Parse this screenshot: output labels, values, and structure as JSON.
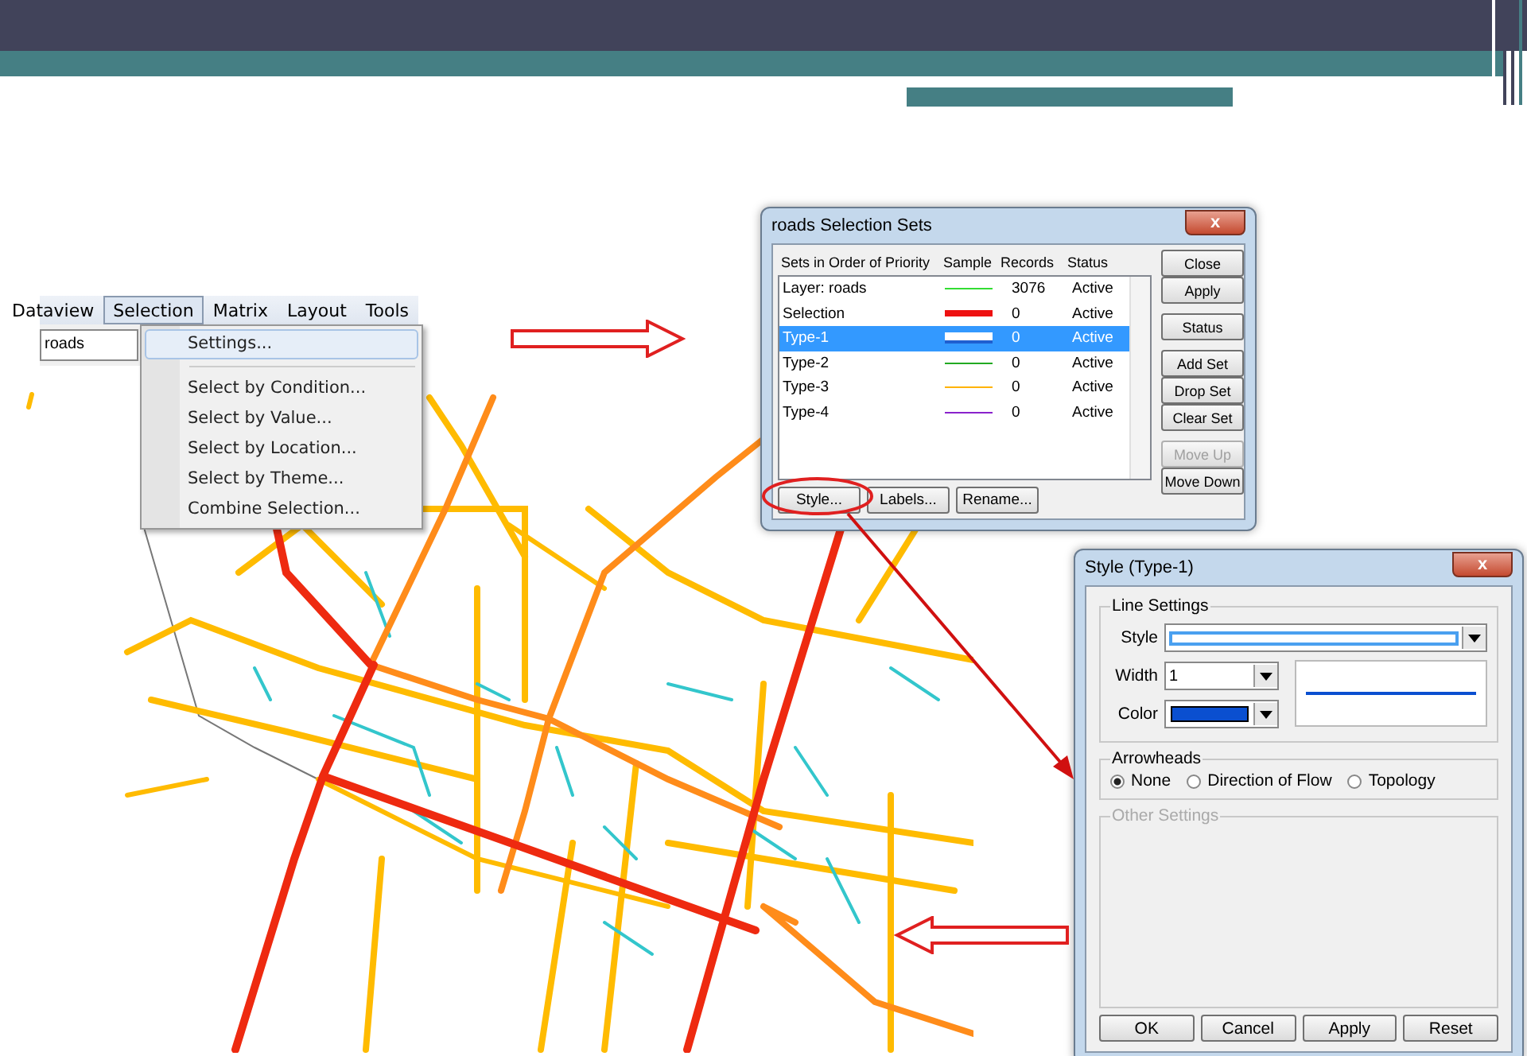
{
  "menu_bar": {
    "items": [
      {
        "label": "Dataview",
        "selected": false
      },
      {
        "label": "Selection",
        "selected": true
      },
      {
        "label": "Matrix",
        "selected": false
      },
      {
        "label": "Layout",
        "selected": false
      },
      {
        "label": "Tools",
        "selected": false
      }
    ]
  },
  "layer_field": {
    "value": "roads"
  },
  "selection_menu": {
    "items": [
      {
        "kind": "item",
        "label": "Settings...",
        "highlighted": true
      },
      {
        "kind": "separator"
      },
      {
        "kind": "item",
        "label": "Select by Condition...",
        "highlighted": false
      },
      {
        "kind": "item",
        "label": "Select by Value...",
        "highlighted": false
      },
      {
        "kind": "item",
        "label": "Select by Location...",
        "highlighted": false
      },
      {
        "kind": "item",
        "label": "Select by Theme...",
        "highlighted": false
      },
      {
        "kind": "item",
        "label": "Combine Selection...",
        "highlighted": false
      }
    ]
  },
  "selection_sets_dialog": {
    "title": "roads Selection Sets",
    "close_symbol": "x",
    "columns": [
      "Sets in Order of Priority",
      "Sample",
      "Records",
      "Status"
    ],
    "rows": [
      {
        "name": "Layer: roads",
        "kind": "thin",
        "color": "#33dd33",
        "records": "3076",
        "status": "Active",
        "selected": false
      },
      {
        "name": "Selection",
        "kind": "thick",
        "color": "#ee1111",
        "records": "0",
        "status": "Active",
        "selected": false
      },
      {
        "name": "Type-1",
        "kind": "double",
        "color": "#1f5fd0",
        "records": "0",
        "status": "Active",
        "selected": true
      },
      {
        "name": "Type-2",
        "kind": "thin",
        "color": "#22aa22",
        "records": "0",
        "status": "Active",
        "selected": false
      },
      {
        "name": "Type-3",
        "kind": "thin",
        "color": "#ffb300",
        "records": "0",
        "status": "Active",
        "selected": false
      },
      {
        "name": "Type-4",
        "kind": "thin",
        "color": "#8a22cc",
        "records": "0",
        "status": "Active",
        "selected": false
      }
    ],
    "side_button_groups": [
      [
        {
          "label": "Close",
          "disabled": false
        },
        {
          "label": "Apply",
          "disabled": false
        }
      ],
      [
        {
          "label": "Status",
          "disabled": false
        }
      ],
      [
        {
          "label": "Add Set",
          "disabled": false
        },
        {
          "label": "Drop Set",
          "disabled": false
        },
        {
          "label": "Clear Set",
          "disabled": false
        }
      ],
      [
        {
          "label": "Move Up",
          "disabled": true
        },
        {
          "label": "Move Down",
          "disabled": false
        }
      ]
    ],
    "bottom_buttons": [
      "Style...",
      "Labels...",
      "Rename..."
    ]
  },
  "style_dialog": {
    "title": "Style (Type-1)",
    "close_symbol": "x",
    "line_settings": {
      "legend": "Line Settings",
      "style_label": "Style",
      "width_label": "Width",
      "width_value": "1",
      "color_label": "Color",
      "color": "#0a4fd0"
    },
    "arrowheads": {
      "legend": "Arrowheads",
      "options": [
        {
          "label": "None",
          "selected": true
        },
        {
          "label": "Direction of Flow",
          "selected": false
        },
        {
          "label": "Topology",
          "selected": false
        }
      ]
    },
    "other_settings": {
      "legend": "Other Settings",
      "disabled": true
    },
    "buttons": [
      "OK",
      "Cancel",
      "Apply",
      "Reset"
    ]
  }
}
